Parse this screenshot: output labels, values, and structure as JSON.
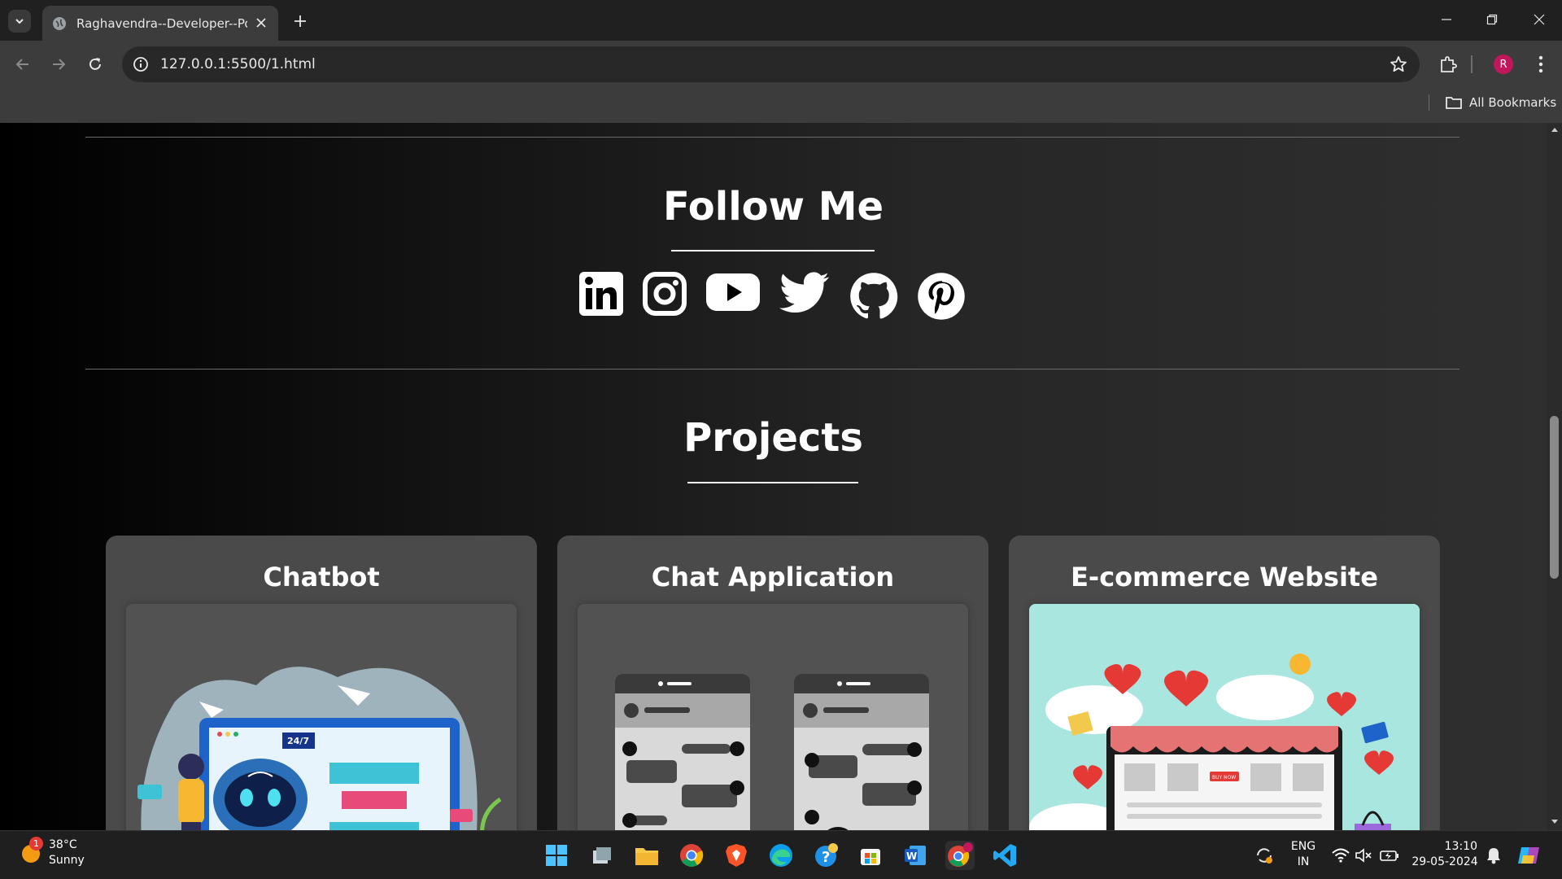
{
  "browser": {
    "tab_title": "Raghavendra--Developer--Portf",
    "url": "127.0.0.1:5500/1.html",
    "bookmarks_label": "All Bookmarks",
    "profile_initial": "R"
  },
  "page": {
    "follow_title": "Follow Me",
    "social_icons": [
      "linkedin-icon",
      "instagram-icon",
      "youtube-icon",
      "twitter-icon",
      "github-icon",
      "pinterest-icon"
    ],
    "projects_title": "Projects",
    "projects": [
      {
        "title": "Chatbot",
        "image_badge": "24/7"
      },
      {
        "title": "Chat Application"
      },
      {
        "title": "E-commerce Website",
        "image_badge": "BUY NOW"
      }
    ]
  },
  "taskbar": {
    "weather_temp": "38°C",
    "weather_cond": "Sunny",
    "weather_alert_count": "1",
    "lang_line1": "ENG",
    "lang_line2": "IN",
    "time": "13:10",
    "date": "29-05-2024"
  },
  "colors": {
    "accent_profile": "#c2185b",
    "page_bg": "#000000",
    "card_bg": "#4a4a4a",
    "ecommerce_bg": "#a8e6df"
  }
}
